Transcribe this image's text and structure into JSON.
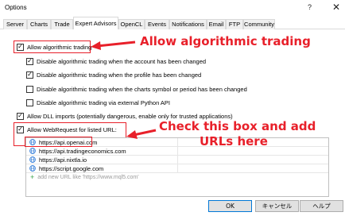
{
  "window": {
    "title": "Options",
    "help_glyph": "?",
    "close_glyph": "✕"
  },
  "tabs": [
    {
      "label": "Server"
    },
    {
      "label": "Charts"
    },
    {
      "label": "Trade"
    },
    {
      "label": "Expert Advisors"
    },
    {
      "label": "OpenCL"
    },
    {
      "label": "Events"
    },
    {
      "label": "Notifications"
    },
    {
      "label": "Email"
    },
    {
      "label": "FTP"
    },
    {
      "label": "Community"
    }
  ],
  "options": {
    "allow_algo": {
      "label": "Allow algorithmic trading",
      "checked": true
    },
    "disable_account": {
      "label": "Disable algorithmic trading when the account has been changed",
      "checked": true
    },
    "disable_profile": {
      "label": "Disable algorithmic trading when the profile has been changed",
      "checked": true
    },
    "disable_symbol": {
      "label": "Disable algorithmic trading when the charts symbol or period has been changed",
      "checked": false
    },
    "disable_python": {
      "label": "Disable algorithmic trading via external Python API",
      "checked": false
    },
    "allow_dll": {
      "label": "Allow DLL imports (potentially dangerous, enable only for trusted applications)",
      "checked": true
    },
    "allow_webrequest": {
      "label": "Allow WebRequest for listed URL:",
      "checked": true
    }
  },
  "annotations": {
    "algo": "Allow algorithmic trading",
    "check_line1": "Check this box and add",
    "check_line2": "URLs here"
  },
  "urls": [
    "https://api.openai.com",
    "https://api.tradingeconomics.com",
    "https://api.nixtla.io",
    "https://script.google.com"
  ],
  "add_url_placeholder": "add new URL like 'https://www.mql5.com'",
  "buttons": {
    "ok": "OK",
    "cancel": "キャンセル",
    "help": "ヘルプ"
  },
  "colors": {
    "annotation_red": "#e8202a",
    "add_plus_green": "#3aa34a",
    "globe_blue": "#2f7bd8"
  }
}
